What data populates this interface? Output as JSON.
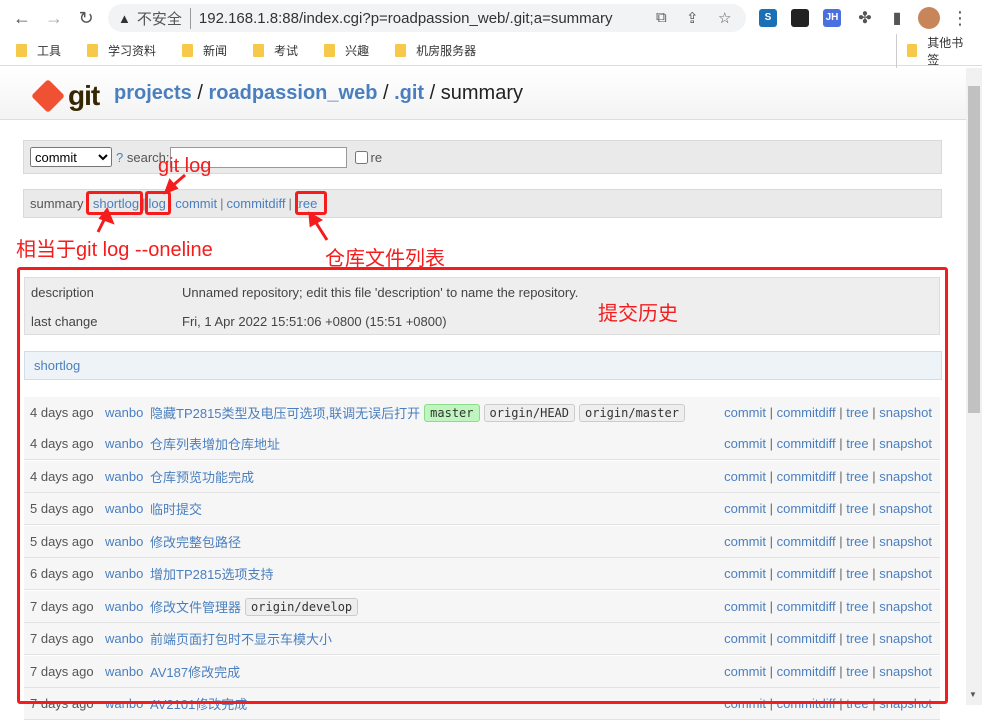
{
  "browser": {
    "url_security": "不安全",
    "url": "192.168.1.8:88/index.cgi?p=roadpassion_web/.git;a=summary",
    "bookmarks": [
      "工具",
      "学习资料",
      "新闻",
      "考试",
      "兴趣",
      "机房服务器"
    ],
    "other_bookmarks": "其他书签",
    "extensions": [
      "S",
      "JH"
    ]
  },
  "header": {
    "logo": "git",
    "crumbs": [
      "projects",
      "roadpassion_web",
      ".git"
    ],
    "current": "summary"
  },
  "search": {
    "type_selected": "commit",
    "help": "?",
    "label": "search:",
    "value": "",
    "re_label": "re"
  },
  "nav": {
    "current": "summary",
    "links": [
      "shortlog",
      "log",
      "commit",
      "commitdiff",
      "tree"
    ]
  },
  "annotations": {
    "log": "git log",
    "shortlog": "相当于git log --oneline",
    "tree": "仓库文件列表",
    "history": "提交历史"
  },
  "project": {
    "description_label": "description",
    "description": "Unnamed repository; edit this file 'description' to name the repository.",
    "last_change_label": "last change",
    "last_change": "Fri, 1 Apr 2022 15:51:06 +0800 (15:51 +0800)"
  },
  "shortlog": {
    "title": "shortlog",
    "link_labels": [
      "commit",
      "commitdiff",
      "tree",
      "snapshot"
    ],
    "rows": [
      {
        "age": "4 days ago",
        "author": "wanbo",
        "msg": "隐藏TP2815类型及电压可选项,联调无误后打开",
        "refs": [
          "master",
          "origin/HEAD",
          "origin/master"
        ]
      },
      {
        "age": "4 days ago",
        "author": "wanbo",
        "msg": "仓库列表增加仓库地址",
        "refs": []
      },
      {
        "age": "4 days ago",
        "author": "wanbo",
        "msg": "仓库预览功能完成",
        "refs": []
      },
      {
        "age": "5 days ago",
        "author": "wanbo",
        "msg": "临时提交",
        "refs": []
      },
      {
        "age": "5 days ago",
        "author": "wanbo",
        "msg": "修改完整包路径",
        "refs": []
      },
      {
        "age": "6 days ago",
        "author": "wanbo",
        "msg": "增加TP2815选项支持",
        "refs": []
      },
      {
        "age": "7 days ago",
        "author": "wanbo",
        "msg": "修改文件管理器",
        "refs": [
          "origin/develop"
        ]
      },
      {
        "age": "7 days ago",
        "author": "wanbo",
        "msg": "前端页面打包时不显示车模大小",
        "refs": []
      },
      {
        "age": "7 days ago",
        "author": "wanbo",
        "msg": "AV187修改完成",
        "refs": []
      },
      {
        "age": "7 days ago",
        "author": "wanbo",
        "msg": "AV2101修改完成",
        "refs": []
      }
    ]
  },
  "colors": {
    "link": "#4a7fbf",
    "annotation": "#f41c1c",
    "head_ref": "#bff5be"
  }
}
